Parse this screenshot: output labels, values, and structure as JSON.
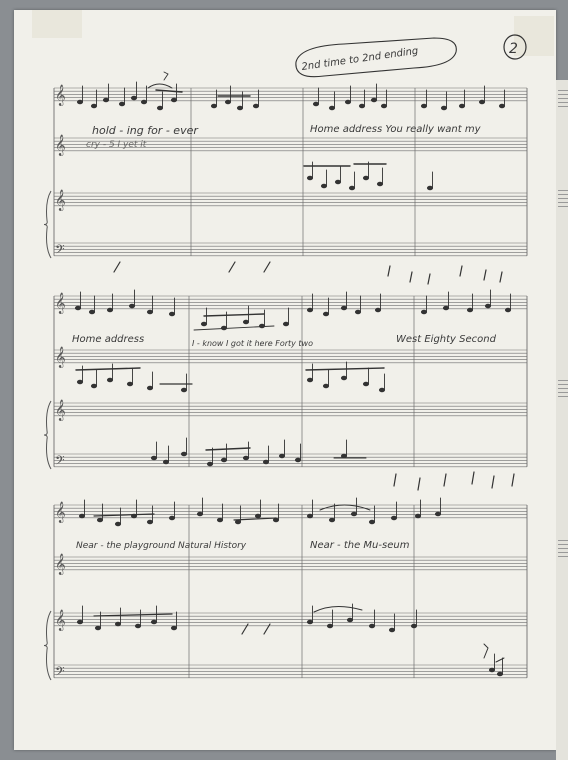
{
  "page": {
    "number": "2",
    "annotation": "2nd time to 2nd ending"
  },
  "systems": [
    {
      "lyrics_line1": "hold - ing for - ever",
      "lyrics_line2": "Home address You really want my",
      "overlay_text": "cry - 5 I   yet it"
    },
    {
      "lyrics_line1": "Home address",
      "lyrics_line2": "I - know I got it here Forty two",
      "lyrics_line3": "West Eighty Second"
    },
    {
      "lyrics_line1": "Near - the playground Natural History",
      "lyrics_line2": "Near - the Mu-seum"
    }
  ]
}
